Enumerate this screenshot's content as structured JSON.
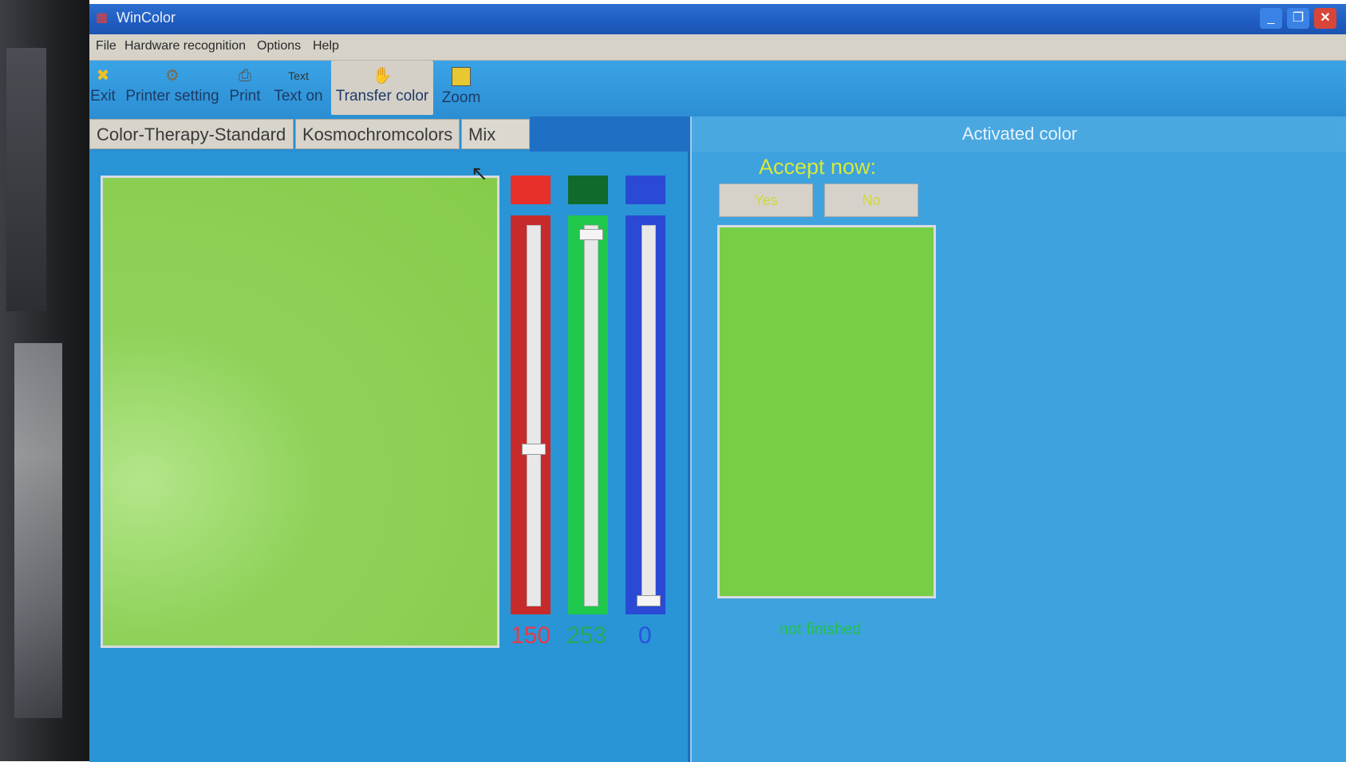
{
  "window": {
    "title": "WinColor",
    "buttons": {
      "minimize": "_",
      "maximize": "❐",
      "close": "✕"
    }
  },
  "menu": [
    "File",
    "Hardware recognition",
    "Options",
    "Help"
  ],
  "toolbar": [
    {
      "label": "Exit",
      "icon": "exit-icon"
    },
    {
      "label": "Printer setting",
      "icon": "printer-setting-icon"
    },
    {
      "label": "Print",
      "icon": "print-icon"
    },
    {
      "label": "Text on",
      "icon": "text-icon"
    },
    {
      "label": "Transfer color",
      "icon": "transfer-color-icon"
    },
    {
      "label": "Zoom",
      "icon": "zoom-icon"
    }
  ],
  "toolbar_icon_glyph": {
    "text": "Text"
  },
  "tabs": [
    "Color-Therapy-Standard",
    "Kosmochromcolors",
    "Mix"
  ],
  "mix": {
    "preview_color": "#8ecf52",
    "red": {
      "value": "150",
      "swatch": "#e8302a",
      "track": "#c62a2a",
      "text_color": "#e63a4a"
    },
    "green": {
      "value": "253",
      "swatch": "#0f6a2c",
      "track": "#1fc84a",
      "text_color": "#27a85a"
    },
    "blue": {
      "value": "0",
      "swatch": "#2a4ad6",
      "track": "#2a4ad6",
      "text_color": "#2a50e0"
    },
    "slider_levels": {
      "red": 0.41,
      "green": 0.99,
      "blue": 0.0
    }
  },
  "activated": {
    "header": "Activated color",
    "accept_label": "Accept now:",
    "yes_label": "Yes",
    "no_label": "No",
    "status": "not finished",
    "color": "#79ce48"
  }
}
